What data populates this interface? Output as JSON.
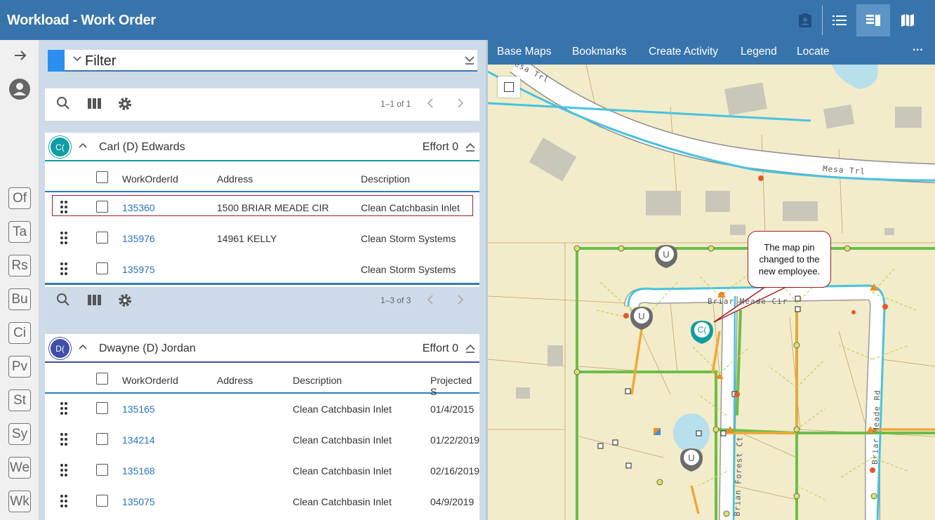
{
  "header": {
    "title": "Workload - Work Order",
    "icons": [
      "clipboard-icon",
      "list-icon",
      "split-view-icon",
      "map-icon"
    ]
  },
  "rail": {
    "badges": [
      "Of",
      "Ta",
      "Rs",
      "Bu",
      "Ci",
      "Pv",
      "St",
      "Sy",
      "We",
      "Wk"
    ]
  },
  "filter": {
    "label": "Filter"
  },
  "toolbar_top": {
    "pager": "1–1 of 1"
  },
  "group1": {
    "avatar": "C(",
    "name": "Carl (D) Edwards",
    "effort": "Effort 0",
    "columns": [
      "WorkOrderId",
      "Address",
      "Description"
    ],
    "rows": [
      {
        "id": "135360",
        "address": "1500 BRIAR MEADE CIR",
        "description": "Clean Catchbasin Inlet"
      },
      {
        "id": "135976",
        "address": "14961 KELLY",
        "description": "Clean Storm Systems"
      },
      {
        "id": "135975",
        "address": "",
        "description": "Clean Storm Systems"
      }
    ],
    "pager": "1–3 of 3"
  },
  "group2": {
    "avatar": "D(",
    "name": "Dwayne (D) Jordan",
    "effort": "Effort 0",
    "columns": [
      "WorkOrderId",
      "Address",
      "Description",
      "Projected S"
    ],
    "rows": [
      {
        "id": "135165",
        "address": "",
        "description": "Clean Catchbasin Inlet",
        "projected": "01/4/2015"
      },
      {
        "id": "134214",
        "address": "",
        "description": "Clean Catchbasin Inlet",
        "projected": "01/22/2019"
      },
      {
        "id": "135168",
        "address": "",
        "description": "Clean Catchbasin Inlet",
        "projected": "02/16/2019"
      },
      {
        "id": "135075",
        "address": "",
        "description": "Clean Catchbasin Inlet",
        "projected": "04/9/2019"
      }
    ]
  },
  "map_toolbar": {
    "items": [
      "Base Maps",
      "Bookmarks",
      "Create Activity",
      "Legend",
      "Locate"
    ],
    "more": "···"
  },
  "map": {
    "street_labels": [
      "esa Trl",
      "Mesa Trl",
      "Briar Meade Cir",
      "Brian Forest Ct",
      "Briar Meade Rd"
    ],
    "pins": [
      "U",
      "U",
      "U",
      "C("
    ],
    "callout": [
      "The map pin",
      "changed to the",
      "new employee."
    ]
  },
  "colors": {
    "brand": "#3774ac",
    "teal": "#109ca3",
    "indigo": "#3f4ea8",
    "highlight": "#a21e22"
  }
}
